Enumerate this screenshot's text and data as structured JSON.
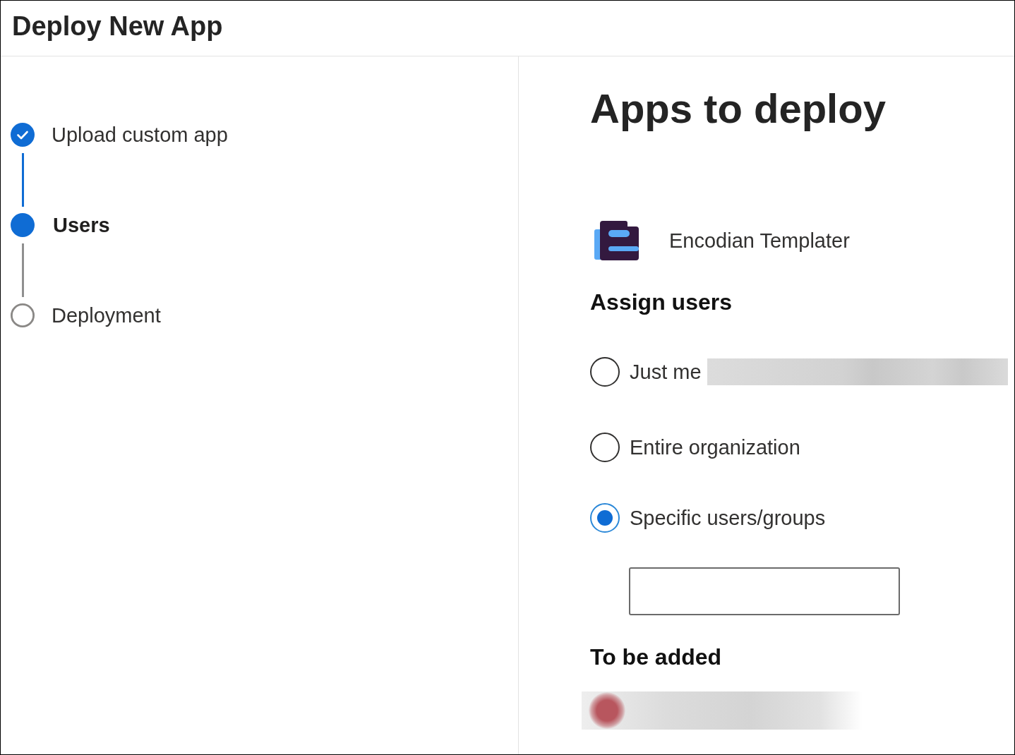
{
  "window": {
    "title": "Deploy New App"
  },
  "steps": [
    {
      "label": "Upload custom app",
      "completed": true,
      "selected": false
    },
    {
      "label": "Users",
      "completed": false,
      "selected": true
    },
    {
      "label": "Deployment",
      "completed": false,
      "selected": false
    }
  ],
  "main": {
    "title": "Apps to deploy",
    "app": {
      "name": "Encodian Templater"
    }
  },
  "assign_users": {
    "heading": "Assign users",
    "options": [
      {
        "label": "Just me",
        "selected": false,
        "redacted_detail": true
      },
      {
        "label": "Entire organization",
        "selected": false,
        "redacted_detail": false
      },
      {
        "label": "Specific users/groups",
        "selected": true,
        "redacted_detail": false
      }
    ]
  },
  "to_be_added": {
    "heading": "To be added",
    "entries": [
      {
        "redacted": true
      }
    ]
  }
}
